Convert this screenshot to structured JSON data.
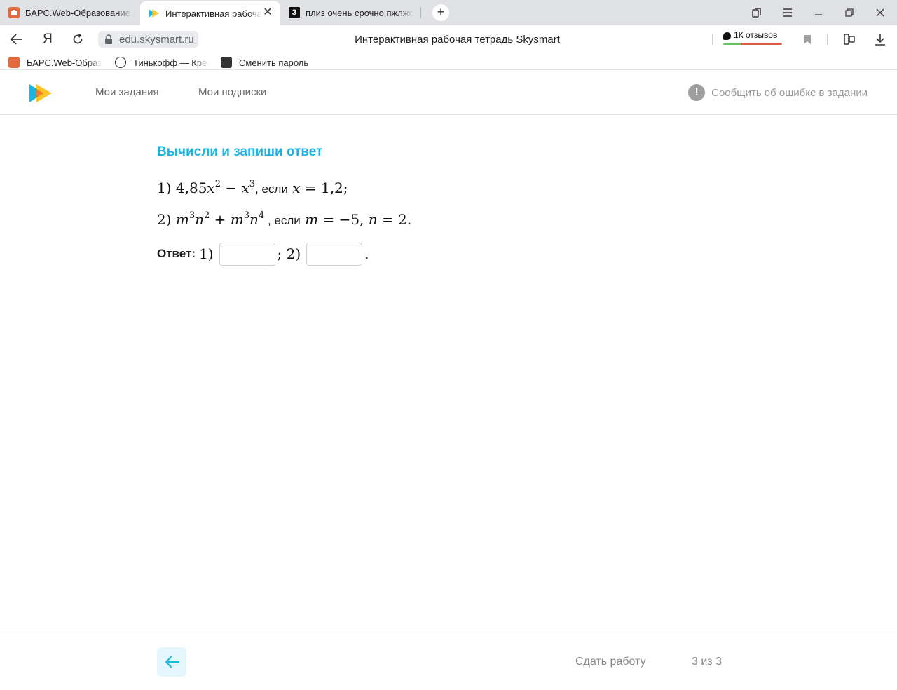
{
  "browser": {
    "tabs": [
      {
        "title": "БАРС.Web-Образование - "
      },
      {
        "title": "Интерактивная рабочая тетрадь Skysmart"
      },
      {
        "title": "плиз очень срочно пжлжста"
      }
    ],
    "url": "edu.skysmart.ru",
    "page_title": "Интерактивная рабочая тетрадь Skysmart",
    "reviews_label": "1К отзывов",
    "tab3_favicon_letter": "З",
    "bookmarks": [
      {
        "title": "БАРС.Web-Образование"
      },
      {
        "title": "Тинькофф — Кредитные"
      },
      {
        "title": "Сменить пароль"
      }
    ]
  },
  "site": {
    "nav": {
      "my_tasks": "Мои задания",
      "my_subscriptions": "Мои подписки",
      "report_error": "Сообщить об ошибке в задании",
      "report_icon_glyph": "!"
    }
  },
  "task": {
    "heading": "Вычисли и запиши ответ",
    "line1": {
      "num": "1)",
      "expr_a": "4,85",
      "var_x": "x",
      "exp2": "2",
      "minus": "−",
      "exp3": "3",
      "word_if": ", если",
      "cond": "= 1,2;"
    },
    "line2": {
      "num": "2)",
      "var_m": "m",
      "var_n": "n",
      "exp3": "3",
      "exp2": "2",
      "plus": "+",
      "exp4": "4",
      "word_if": " , если",
      "cond_m": "= −5,",
      "cond_n": "= 2."
    },
    "answer": {
      "label": "Ответ:",
      "part1": "1)",
      "separator": "; 2)",
      "end": ".",
      "value1": "",
      "value2": ""
    }
  },
  "footer": {
    "submit": "Сдать работу",
    "pager": "3 из 3"
  },
  "colors": {
    "accent": "#1cb4e3",
    "back_button_bg": "#e3f6fd",
    "logo_blue": "#1cb4e3",
    "logo_yellow": "#fcc010"
  }
}
